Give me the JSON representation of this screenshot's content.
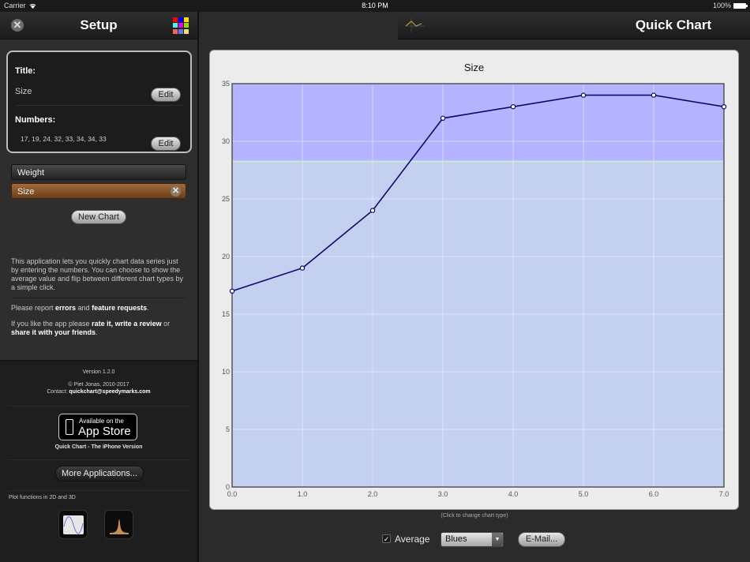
{
  "status_bar": {
    "carrier": "Carrier",
    "time": "8:10 PM",
    "battery": "100%"
  },
  "sidebar": {
    "title": "Setup",
    "palette_colors": [
      "#ff0000",
      "#0000ff",
      "#ffdd00",
      "#55eeee",
      "#ee00ee",
      "#99dd00",
      "#ee6666",
      "#6677ee",
      "#eedd77"
    ],
    "setup_card": {
      "title_label": "Title:",
      "title_value": "Size",
      "numbers_label": "Numbers:",
      "numbers_value": "17, 19, 24, 32, 33, 34, 34, 33",
      "edit_label": "Edit"
    },
    "series": [
      {
        "label": "Weight",
        "selected": false
      },
      {
        "label": "Size",
        "selected": true
      }
    ],
    "new_chart_label": "New Chart",
    "about": {
      "p1": "This application lets you quickly chart data series just by entering the numbers. You can choose to show the average value and flip between different chart types by a simple click.",
      "p2_pre": "Please report ",
      "p2_errors": "errors",
      "p2_mid": " and ",
      "p2_features": "feature requests",
      "p2_post": ".",
      "p3_pre": "If you like the app please ",
      "p3_rate": "rate it, write a review",
      "p3_mid": " or ",
      "p3_share": "share it with your friends",
      "p3_post": "."
    },
    "footer": {
      "version": "Version 1.2.0",
      "copyright": "© Piet Jonas, 2010-2017",
      "contact_label": "Contact: ",
      "contact_email": "quickchart@speedymarks.com",
      "appstore_small": "Available on the",
      "appstore_big": "App Store",
      "iphone_version": "Quick Chart - The iPhone Version",
      "more_apps_label": "More Applications...",
      "plot_functions": "Plot functions in 2D and 3D"
    }
  },
  "main": {
    "title": "Quick Chart",
    "hint": "(Click to change chart type)",
    "average_label": "Average",
    "average_checked": true,
    "color_scheme": "Blues",
    "email_label": "E-Mail..."
  },
  "chart_data": {
    "type": "line",
    "title": "Size",
    "x": [
      0,
      1,
      2,
      3,
      4,
      5,
      6,
      7
    ],
    "values": [
      17,
      19,
      24,
      32,
      33,
      34,
      34,
      33
    ],
    "xlim": [
      0,
      7
    ],
    "ylim": [
      0,
      35
    ],
    "xticks": [
      "0.0",
      "1.0",
      "2.0",
      "3.0",
      "4.0",
      "5.0",
      "6.0",
      "7.0"
    ],
    "yticks": [
      0,
      5,
      10,
      15,
      20,
      25,
      30,
      35
    ],
    "average": 28.25,
    "grid": true,
    "colors": {
      "above_average": "#b3b3ff",
      "below_average": "#c3d0f0",
      "line": "#0a0a6e",
      "average_line": "#cfe8d0"
    }
  }
}
